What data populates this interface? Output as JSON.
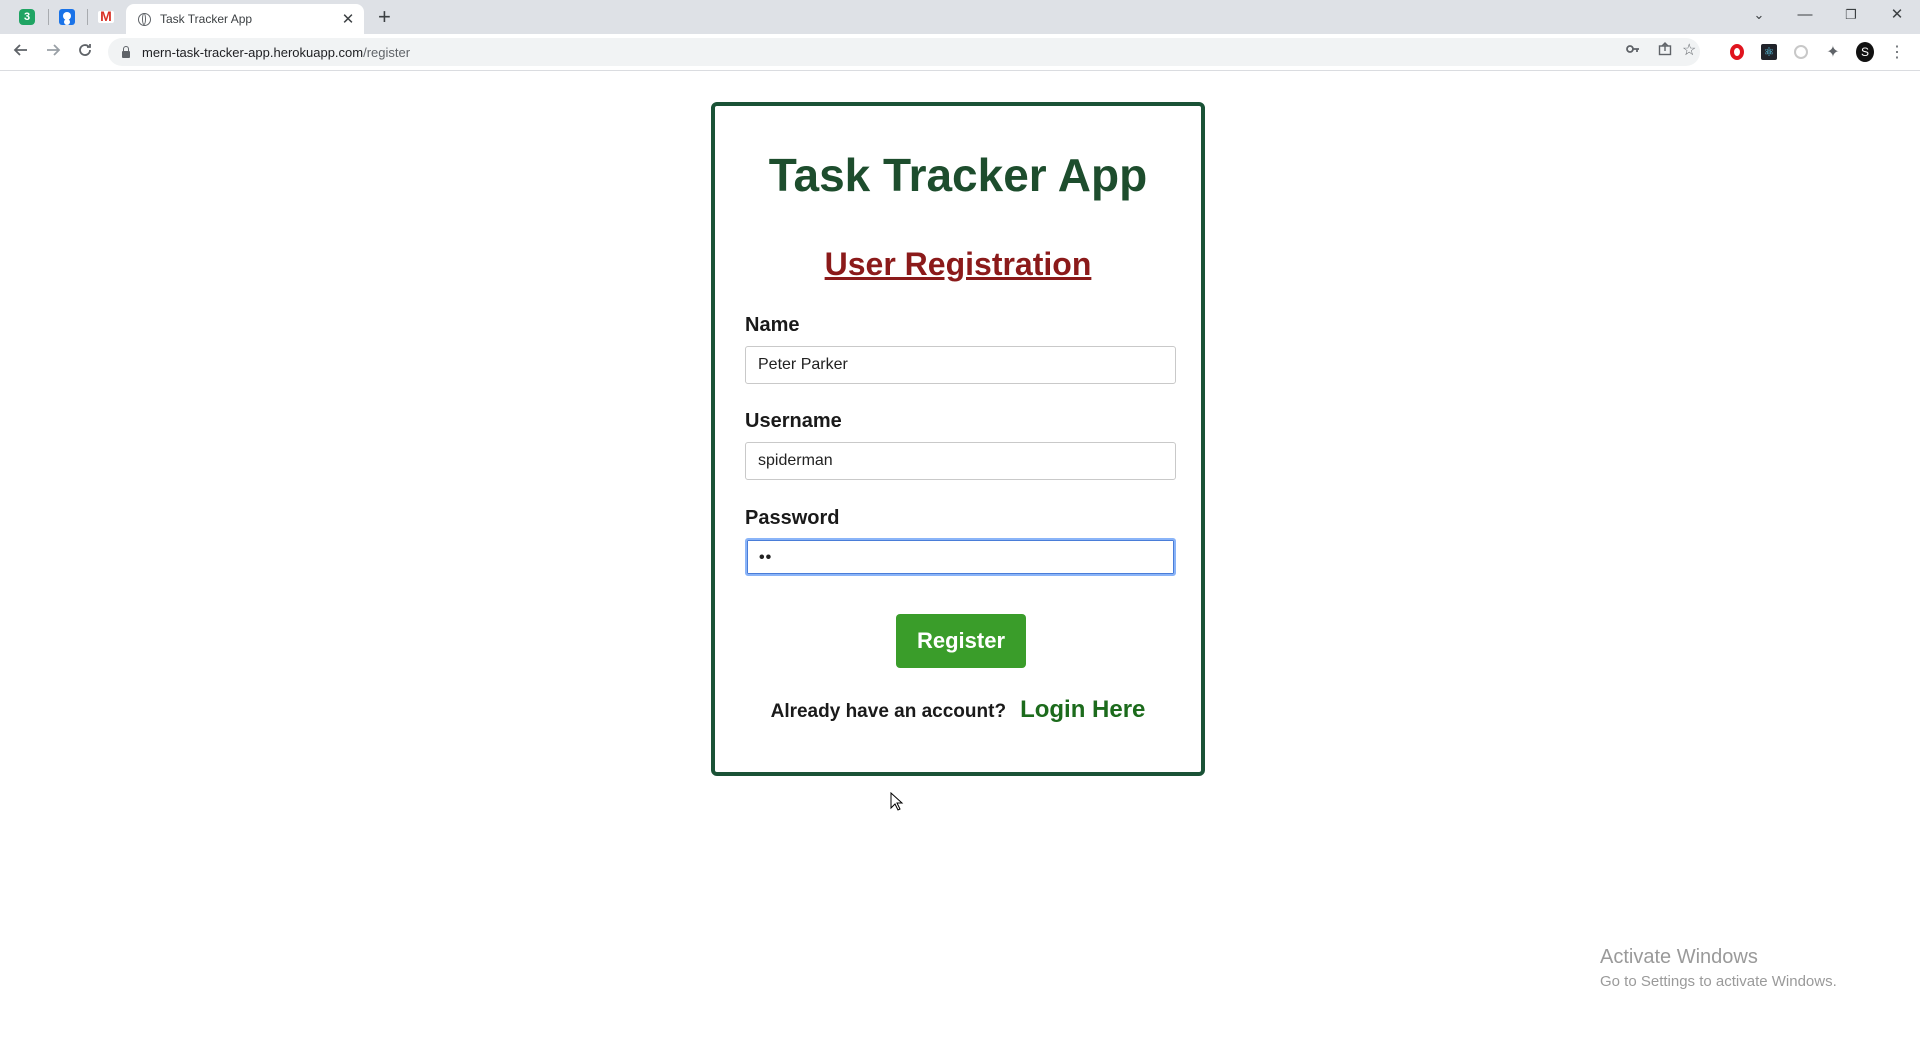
{
  "browser": {
    "tab_title": "Task Tracker App",
    "pinned_tab_badge": "3",
    "url_host": "mern-task-tracker-app.herokuapp.com",
    "url_path": "/register",
    "profile_initial": "S"
  },
  "page": {
    "app_title": "Task Tracker App",
    "form_title": "User Registration",
    "fields": {
      "name": {
        "label": "Name",
        "value": "Peter Parker"
      },
      "username": {
        "label": "Username",
        "value": "spiderman"
      },
      "password": {
        "label": "Password",
        "value": "••"
      }
    },
    "register_label": "Register",
    "login_prompt": "Already have an account?",
    "login_link": "Login Here"
  },
  "os": {
    "activation_title": "Activate Windows",
    "activation_hint": "Go to Settings to activate Windows."
  },
  "colors": {
    "card_border": "#1a5236",
    "app_title": "#1d4d2d",
    "form_title": "#8b1a1a",
    "register_button": "#3a9d2a",
    "login_link": "#1c6b1c"
  }
}
